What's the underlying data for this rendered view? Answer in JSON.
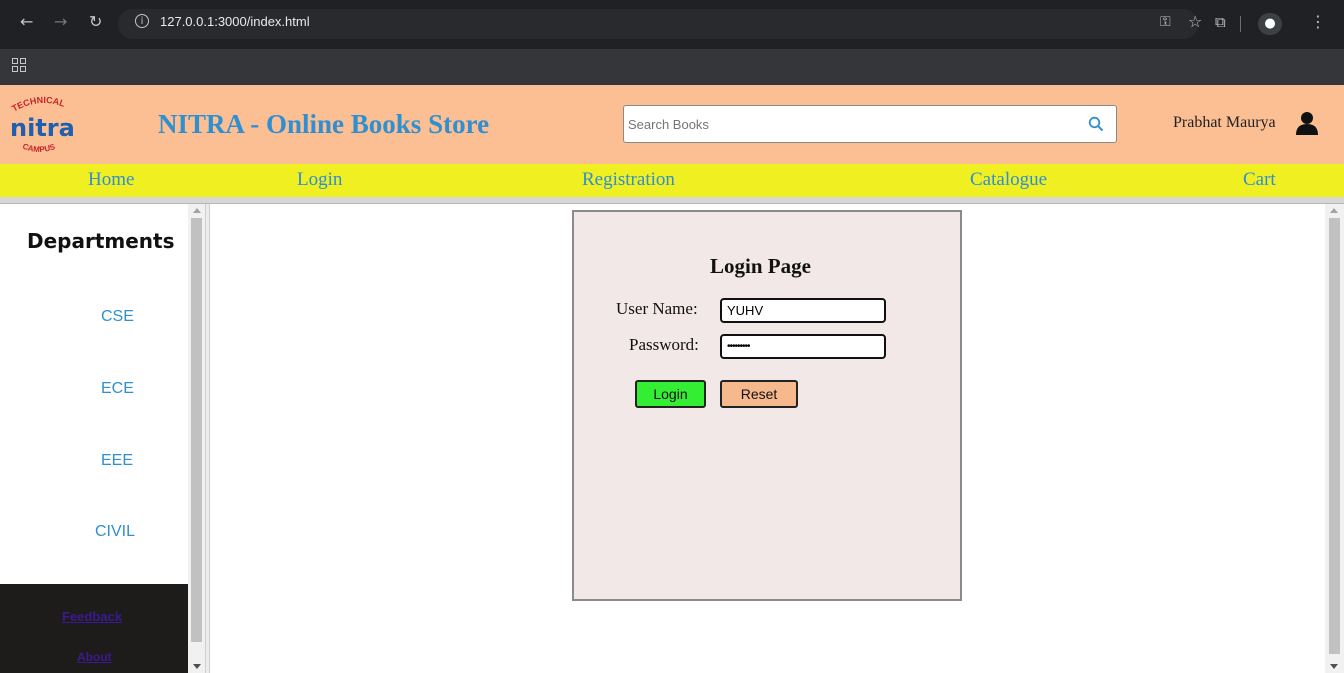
{
  "browser": {
    "url": "127.0.0.1:3000/index.html"
  },
  "site": {
    "title": "NITRA - Online Books Store",
    "logo": {
      "text": "nitra",
      "top_arc": "TECHNICAL",
      "bottom_arc": "CAMPUS"
    },
    "search": {
      "placeholder": "Search Books",
      "value": ""
    },
    "user": {
      "name": "Prabhat Maurya"
    }
  },
  "nav": {
    "items": [
      "Home",
      "Login",
      "Registration",
      "Catalogue",
      "Cart"
    ]
  },
  "sidebar": {
    "title": "Departments",
    "departments": [
      "CSE",
      "ECE",
      "EEE",
      "CIVIL"
    ],
    "footer": {
      "feedback": "Feedback",
      "about": "About"
    }
  },
  "login": {
    "title": "Login Page",
    "username_label": "User Name:",
    "username_value": "YUHV",
    "password_label": "Password:",
    "password_value": "•••••••••",
    "login_button": "Login",
    "reset_button": "Reset"
  },
  "colors": {
    "header_bg": "#fbbf93",
    "nav_bg": "#efef22",
    "accent": "#2f8fd0",
    "login_button": "#33ee33",
    "reset_button": "#f6b98e"
  }
}
